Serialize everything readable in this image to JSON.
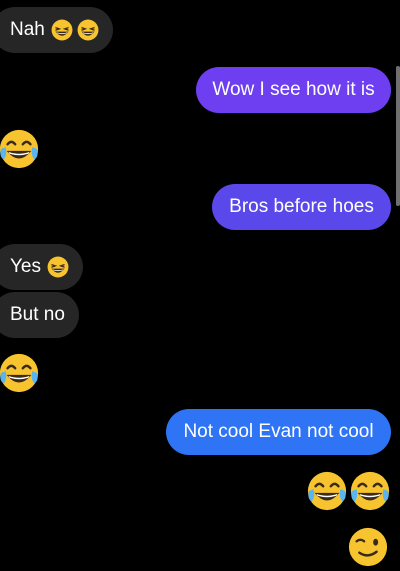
{
  "messages": [
    {
      "side": "incoming",
      "text": "Nah",
      "emojis": [
        "grin-squint",
        "grin-squint"
      ]
    },
    {
      "side": "outgoing",
      "text": "Wow I see how it is"
    },
    {
      "side": "incoming",
      "emoji_only": [
        "joy"
      ]
    },
    {
      "side": "outgoing",
      "text": "Bros before hoes"
    },
    {
      "side": "incoming",
      "text": "Yes",
      "emojis": [
        "grin-squint"
      ]
    },
    {
      "side": "incoming",
      "text": "But no"
    },
    {
      "side": "incoming",
      "emoji_only": [
        "joy"
      ]
    },
    {
      "side": "outgoing",
      "text": "Not cool Evan not cool"
    },
    {
      "side": "outgoing",
      "emoji_only": [
        "joy",
        "joy"
      ]
    },
    {
      "side": "outgoing",
      "emoji_only": [
        "wink"
      ]
    }
  ],
  "colors": {
    "background": "#000000",
    "incoming_bubble": "#262626",
    "outgoing_bubble_purple": "#6d3ff0",
    "outgoing_bubble_violet": "#5a48ea",
    "outgoing_bubble_blue": "#2f74f5",
    "text": "#ffffff"
  }
}
